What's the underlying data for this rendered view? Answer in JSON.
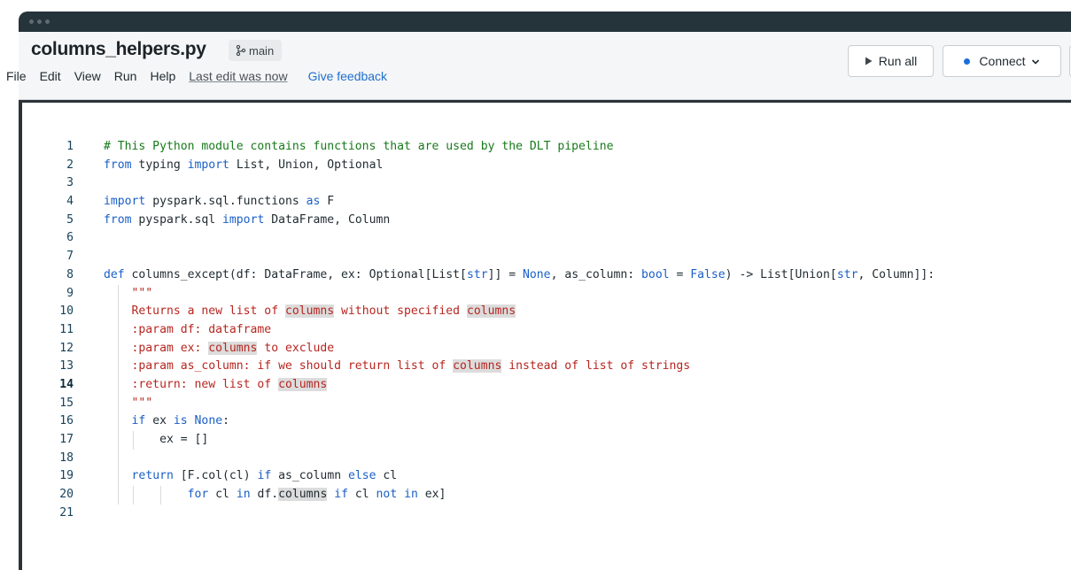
{
  "window": {
    "filename": "columns_helpers.py",
    "branch": "main"
  },
  "menu": {
    "items": [
      "File",
      "Edit",
      "View",
      "Run",
      "Help"
    ],
    "last_edit": "Last edit was now",
    "feedback": "Give feedback"
  },
  "toolbar": {
    "run_all": "Run all",
    "connect": "Connect"
  },
  "editor": {
    "current_line": 14,
    "line_numbers": [
      "1",
      "2",
      "3",
      "4",
      "5",
      "6",
      "7",
      "8",
      "9",
      "10",
      "11",
      "12",
      "13",
      "14",
      "15",
      "16",
      "17",
      "18",
      "19",
      "20",
      "21"
    ],
    "lines": [
      "# This Python module contains functions that are used by the DLT pipeline",
      "from typing import List, Union, Optional",
      "",
      "import pyspark.sql.functions as F",
      "from pyspark.sql import DataFrame, Column",
      "",
      "",
      "def columns_except(df: DataFrame, ex: Optional[List[str]] = None, as_column: bool = False) -> List[Union[str, Column]]:",
      "    \"\"\"",
      "    Returns a new list of columns without specified columns",
      "    :param df: dataframe",
      "    :param ex: columns to exclude",
      "    :param as_column: if we should return list of columns instead of list of strings",
      "    :return: new list of columns",
      "    \"\"\"",
      "    if ex is None:",
      "        ex = []",
      "",
      "    return [F.col(cl) if as_column else cl",
      "            for cl in df.columns if cl not in ex]",
      ""
    ]
  }
}
